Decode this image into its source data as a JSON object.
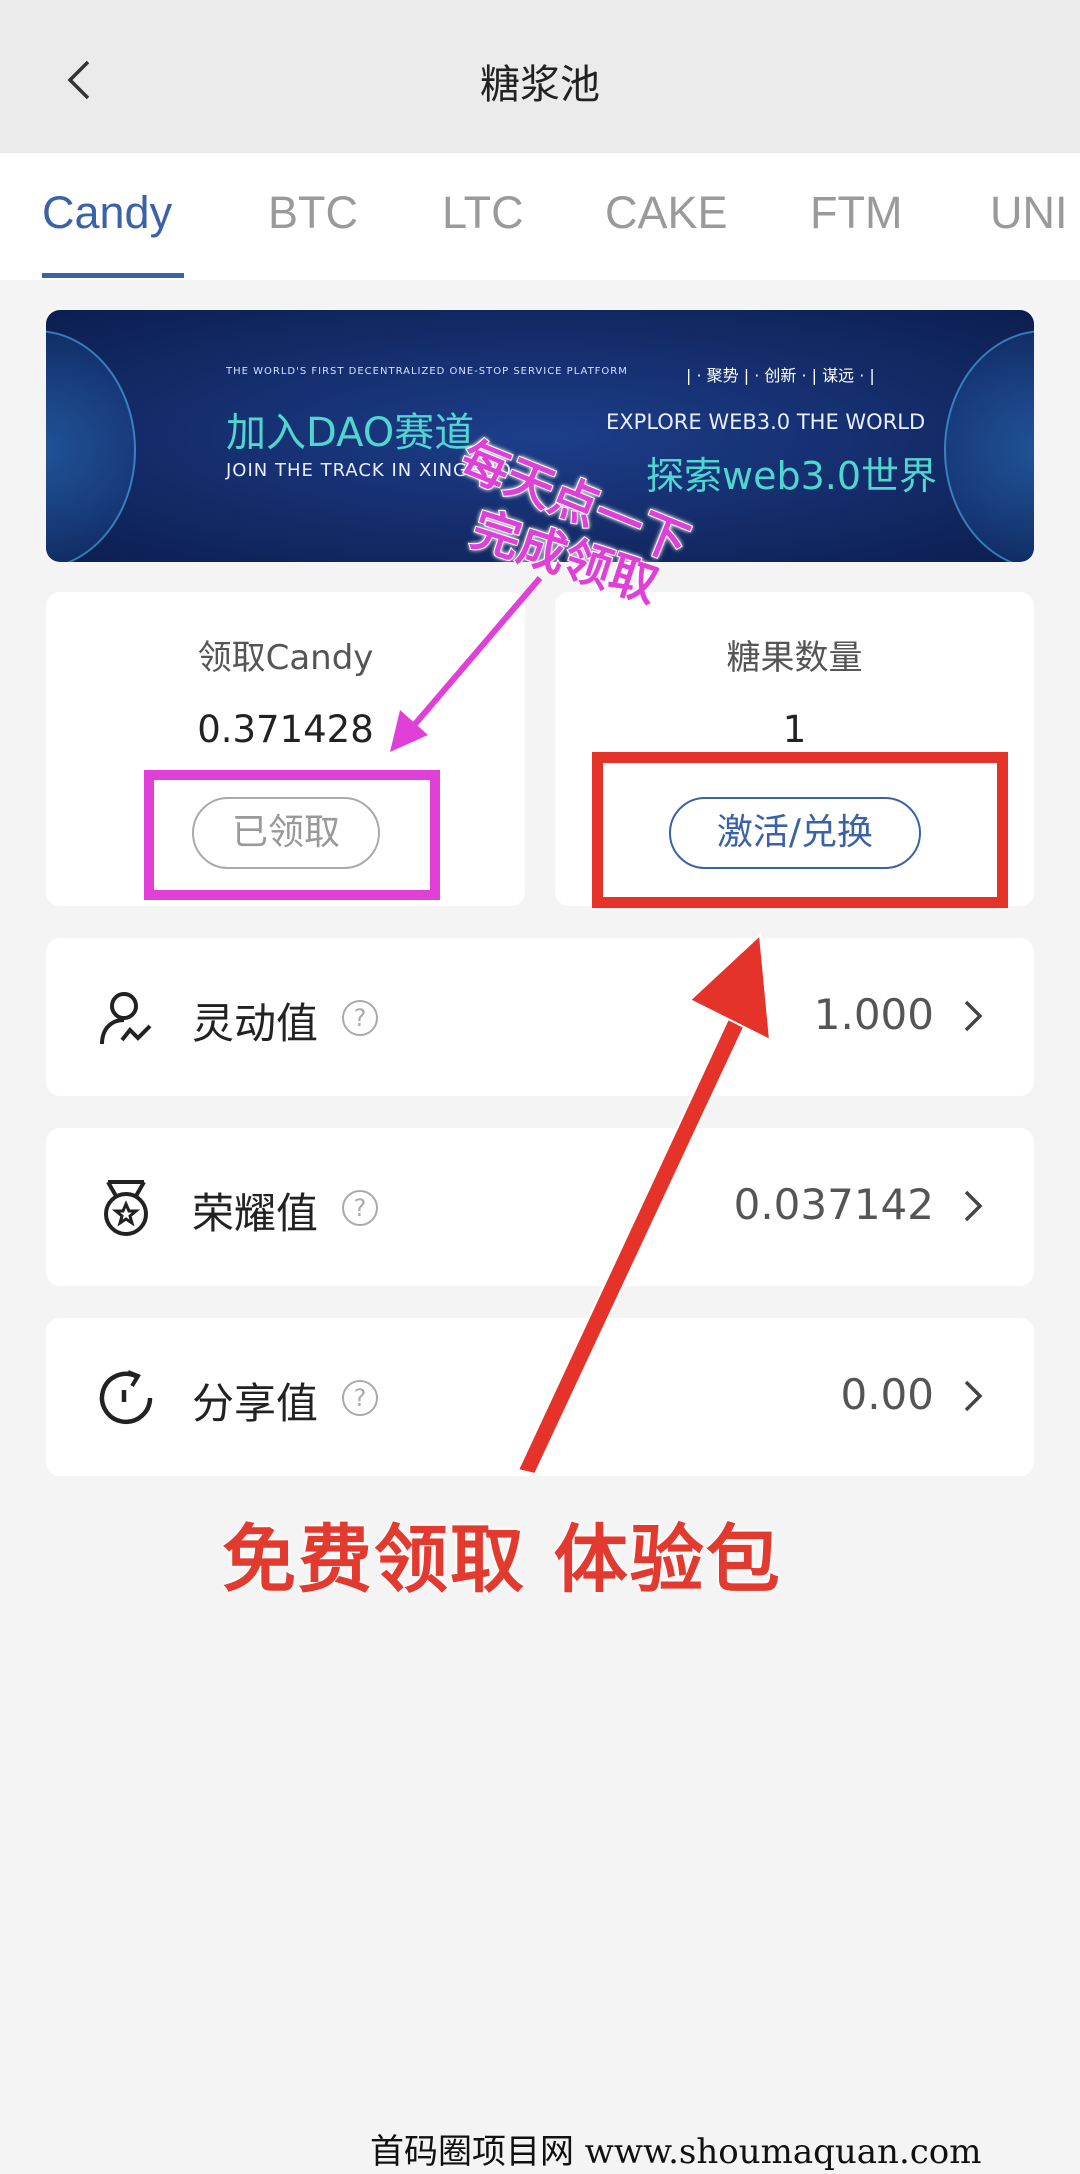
{
  "header": {
    "title": "糖浆池",
    "back_icon": "chevron-left-icon"
  },
  "tabs": [
    {
      "label": "Candy",
      "active": true
    },
    {
      "label": "BTC"
    },
    {
      "label": "LTC"
    },
    {
      "label": "CAKE"
    },
    {
      "label": "FTM"
    },
    {
      "label": "UNI"
    }
  ],
  "banner": {
    "tagline": "THE WORLD'S FIRST DECENTRALIZED ONE-STOP SERVICE PLATFORM",
    "tags": "| · 聚势 | · 创新 · | 谋远 · |",
    "title_cn": "加入DAO赛道",
    "title_en": "JOIN THE TRACK IN XINGHUO",
    "explore_en": "EXPLORE WEB3.0 THE WORLD",
    "explore_cn": "探索web3.0世界"
  },
  "cards": {
    "claim": {
      "title": "领取Candy",
      "value": "0.371428",
      "button": "已领取"
    },
    "candy_count": {
      "title": "糖果数量",
      "value": "1",
      "button": "激活/兑换"
    }
  },
  "rows": [
    {
      "label": "灵动值",
      "value": "1.000",
      "icon": "user-activity-icon"
    },
    {
      "label": "荣耀值",
      "value": "0.037142",
      "icon": "medal-icon"
    },
    {
      "label": "分享值",
      "value": "0.00",
      "icon": "refresh-circle-icon"
    }
  ],
  "help_symbol": "?",
  "annotations": {
    "pink_line1": "每天点一下",
    "pink_line2": "完成领取",
    "red_text": "免费领取 体验包",
    "pink_color": "#e040d8",
    "red_color": "#e23a2e"
  },
  "watermark": "首码圈项目网 www.shoumaquan.com",
  "colors": {
    "accent": "#3a62a8"
  }
}
